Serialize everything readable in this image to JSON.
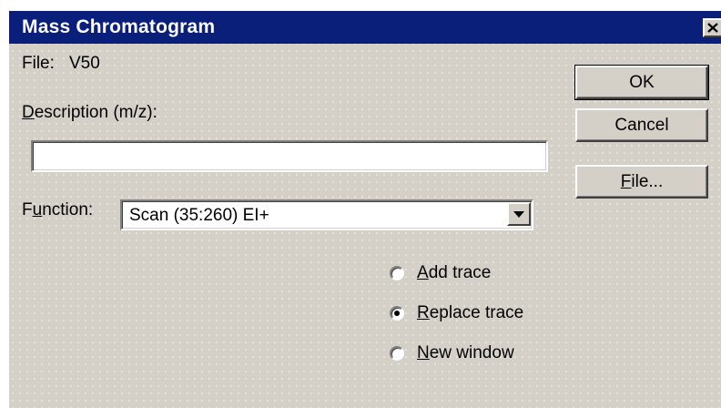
{
  "window": {
    "title": "Mass Chromatogram"
  },
  "file": {
    "label": "File:",
    "value": "V50"
  },
  "description": {
    "label_mnemonic": "D",
    "label_rest": "escription (m/z):",
    "value": ""
  },
  "function": {
    "label_pre": "F",
    "label_mnemonic": "u",
    "label_rest": "nction:",
    "selected": "Scan (35:260) EI+"
  },
  "buttons": {
    "ok": "OK",
    "cancel": "Cancel",
    "file_mnemonic": "F",
    "file_rest": "ile..."
  },
  "trace_options": [
    {
      "mnemonic": "A",
      "rest": "dd trace",
      "checked": false
    },
    {
      "mnemonic": "R",
      "rest": "eplace trace",
      "checked": true
    },
    {
      "mnemonic": "N",
      "rest": "ew window",
      "checked": false
    }
  ],
  "colors": {
    "titlebar": "#0a1f7a",
    "face": "#d4d0c8"
  },
  "icons": {
    "close": "close-icon",
    "dropdown": "chevron-down-icon"
  }
}
